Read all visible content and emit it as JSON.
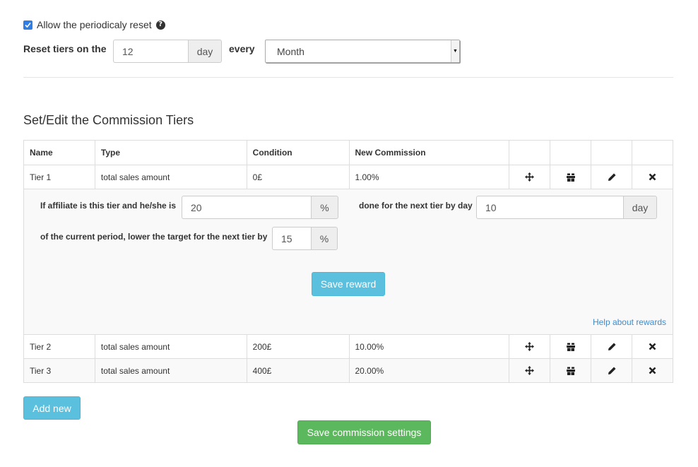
{
  "reset": {
    "allow_label": "Allow the periodicaly reset",
    "allow_checked": true,
    "reset_on_label": "Reset tiers on the",
    "day_value": "12",
    "day_addon": "day",
    "every_label": "every",
    "period_selected": "Month"
  },
  "section_title": "Set/Edit the Commission Tiers",
  "table": {
    "headers": [
      "Name",
      "Type",
      "Condition",
      "New Commission"
    ],
    "rows": [
      {
        "name": "Tier 1",
        "type": "total sales amount",
        "condition": "0£",
        "commission": "1.00%"
      },
      {
        "name": "Tier 2",
        "type": "total sales amount",
        "condition": "200£",
        "commission": "10.00%"
      },
      {
        "name": "Tier 3",
        "type": "total sales amount",
        "condition": "400£",
        "commission": "20.00%"
      }
    ]
  },
  "reward": {
    "label_if": "If affiliate is this tier and he/she is",
    "percent_value": "20",
    "percent_addon": "%",
    "label_done": "done for the next tier by day",
    "day_value": "10",
    "day_addon": "day",
    "label_lower": "of the current period, lower the target for the next tier by",
    "lower_value": "15",
    "lower_addon": "%",
    "save_button": "Save reward",
    "help_link": "Help about rewards"
  },
  "buttons": {
    "add_new": "Add new",
    "save_settings": "Save commission settings"
  },
  "colors": {
    "info": "#5bc0de",
    "success": "#5cb85c",
    "link": "#428bca",
    "checkbox": "#2f7ee6"
  },
  "icons": [
    "move-icon",
    "gift-icon",
    "pencil-icon",
    "remove-icon"
  ]
}
